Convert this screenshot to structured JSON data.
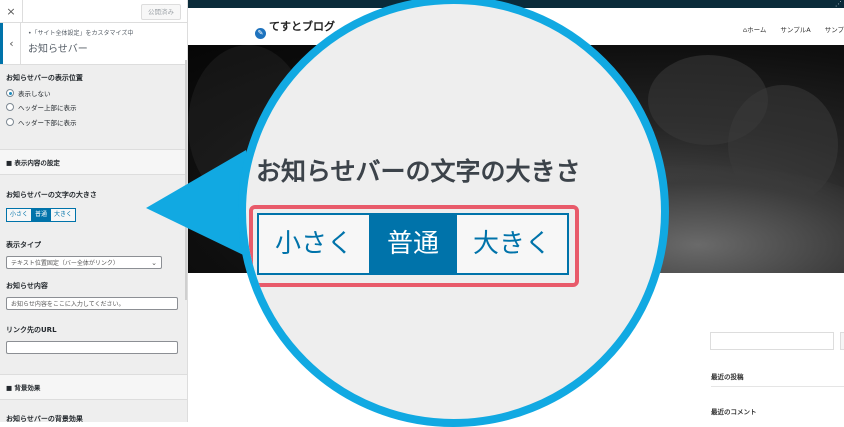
{
  "customizer": {
    "close_icon": "×",
    "publish_label": "公開済み",
    "back_icon": "‹",
    "breadcrumb": "•「サイト全体設定」をカスタマイズ中",
    "section_title": "お知らせバー",
    "position": {
      "title": "お知らせバーの表示位置",
      "options": [
        "表示しない",
        "ヘッダー上部に表示",
        "ヘッダー下部に表示"
      ],
      "selected_index": 0
    },
    "content_section_label": "■ 表示内容の設定",
    "font_size": {
      "title": "お知らせバーの文字の大きさ",
      "options": [
        "小さく",
        "普通",
        "大きく"
      ],
      "selected": "普通"
    },
    "display_type": {
      "title": "表示タイプ",
      "value": "テキスト位置固定（バー全体がリンク）",
      "caret_icon": "⌄"
    },
    "content": {
      "title": "お知らせ内容",
      "placeholder": "お知らせ内容をここに入力してください。"
    },
    "link_url": {
      "title": "リンク先のURL",
      "value": ""
    },
    "bg_section_label": "■ 背景効果",
    "bg_effect_title": "お知らせバーの背景効果"
  },
  "site": {
    "title": "てすとブログ",
    "logo_icon": "✎",
    "rss_icon": "⋰",
    "nav": [
      {
        "icon": "⌂",
        "label": "ホーム"
      },
      {
        "icon": "",
        "label": "サンプルA"
      },
      {
        "icon": "",
        "label": "サンプ"
      }
    ],
    "widgets": [
      "最近の投稿",
      "最近のコメント"
    ]
  },
  "zoom": {
    "title": "お知らせバーの文字の大きさ",
    "options": [
      "小さく",
      "普通",
      "大きく"
    ],
    "selected": "普通"
  },
  "colors": {
    "accent": "#0073aa",
    "callout_ring": "#11a9e2",
    "highlight": "#e85a6a"
  }
}
